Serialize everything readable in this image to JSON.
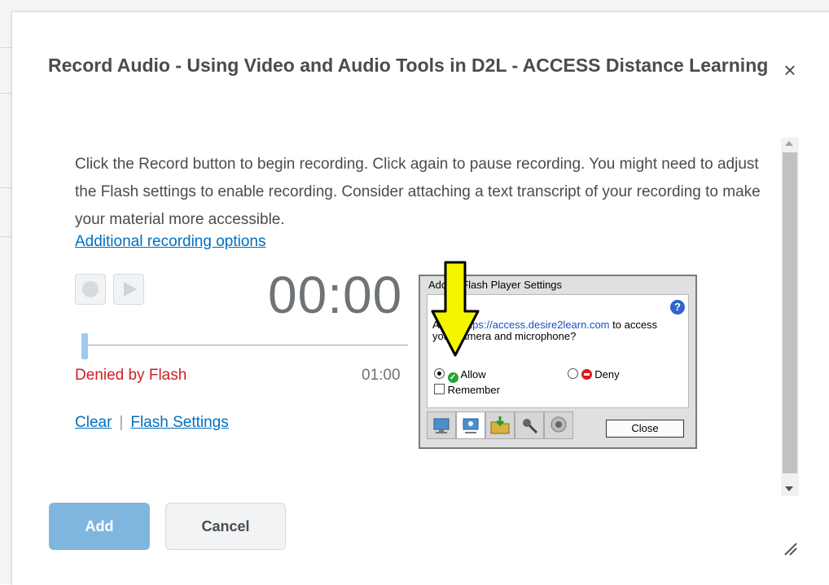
{
  "dialog": {
    "title": "Record Audio - Using Video and Audio Tools in D2L - ACCESS Distance Learning",
    "close_icon": "×"
  },
  "recorder": {
    "description": "Click the Record button to begin recording. Click again to pause recording. You might need to adjust the Flash settings to enable recording. Consider attaching a text transcript of your recording to make your material more accessible.",
    "more_options_link": "Additional recording options",
    "timer": "00:00",
    "status": "Denied by Flash",
    "max_duration": "01:00",
    "clear_link": "Clear",
    "separator": "|",
    "flash_settings_link": "Flash Settings",
    "progress": 0
  },
  "flash_panel": {
    "title": "Adobe Flash Player Settings",
    "help_icon": "?",
    "question_prefix": "Allow",
    "url": "https://access.desire2learn.com",
    "question_suffix": "to access your camera and microphone?",
    "allow_label": "Allow",
    "deny_label": "Deny",
    "remember_label": "Remember",
    "close_label": "Close",
    "selected": "allow",
    "tabs": [
      "display-icon",
      "privacy-icon",
      "storage-icon",
      "microphone-icon",
      "camera-icon"
    ]
  },
  "footer": {
    "add_label": "Add",
    "cancel_label": "Cancel"
  },
  "colors": {
    "link": "#006fbf",
    "denied": "#cd2026",
    "primary_button": "#7fb6de",
    "arrow": "#f5f500"
  }
}
